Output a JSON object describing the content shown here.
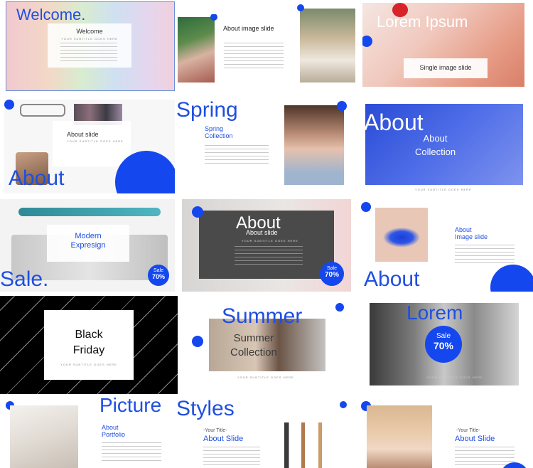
{
  "slides": {
    "welcome": {
      "big_title": "Welcome.",
      "card_title": "Welcome",
      "subtitle": "YOUR SUBTITLE GOES HERE"
    },
    "about_image": {
      "title": "About image slide"
    },
    "lorem_ipsum": {
      "big_title": "Lorem Ipsum",
      "card_title": "Single image slide"
    },
    "about_slide": {
      "card_title": "About slide",
      "subtitle": "YOUR SUBTITLE GOES HERE",
      "big_title": "About"
    },
    "spring": {
      "big_title": "Spring",
      "title": "Spring\nCollection"
    },
    "about_collection": {
      "big_title": "About",
      "title": "About\nCollection",
      "subtitle": "YOUR SUBTITLE GOES HERE"
    },
    "modern": {
      "title": "Modern\nExpresign",
      "big_title": "Sale.",
      "sale_label": "Sale",
      "sale_value": "70%"
    },
    "about_dark": {
      "big_title": "About",
      "card_title": "About slide",
      "subtitle": "YOUR SUBTITLE GOES HERE",
      "sale_label": "Sale",
      "sale_value": "70%"
    },
    "about_lips": {
      "title": "About\nImage slide",
      "big_title": "About"
    },
    "black_friday": {
      "title": "Black\nFriday",
      "subtitle": "YOUR SUBTITLE GOES HERE"
    },
    "summer": {
      "big_title": "Summer",
      "title": "Summer\nCollection",
      "subtitle": "YOUR SUBTITLE GOES HERE"
    },
    "lorem_bw": {
      "big_title": "Lorem",
      "sale_label": "Sale",
      "sale_value": "70%",
      "subtitle": "YOUR SUBTITLE GOES HERE"
    },
    "portfolio": {
      "big_title": "Picture",
      "title": "About\nPortfolio"
    },
    "styles": {
      "big_title": "Styles",
      "kicker": "-Your Title-",
      "title": "About Slide"
    },
    "about_slide_right": {
      "kicker": "-Your Title-",
      "title": "About Slide"
    }
  },
  "colors": {
    "accent": "#1447ee",
    "text_blue": "#1f4fe0",
    "black_bg": "#000000"
  }
}
